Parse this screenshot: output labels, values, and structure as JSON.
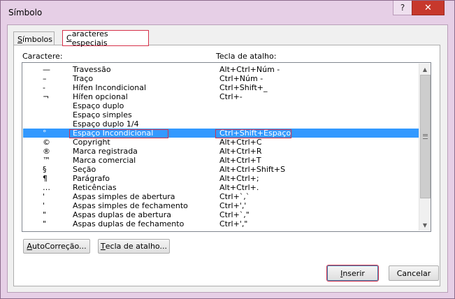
{
  "window": {
    "title": "Símbolo",
    "help_label": "?",
    "close_label": "✕"
  },
  "tabs": [
    {
      "label_accel": "S",
      "label_rest": "ímbolos"
    },
    {
      "label_accel": "C",
      "label_rest": "aracteres especiais"
    }
  ],
  "columns": {
    "character": "Caractere:",
    "shortcut": "Tecla de atalho:"
  },
  "rows": [
    {
      "char": "—",
      "name": "Travessão",
      "shortcut": "Alt+Ctrl+Núm -"
    },
    {
      "char": "–",
      "name": "Traço",
      "shortcut": "Ctrl+Núm -"
    },
    {
      "char": "‑",
      "name": "Hífen Incondicional",
      "shortcut": "Ctrl+Shift+_"
    },
    {
      "char": "¬",
      "name": "Hífen opcional",
      "shortcut": "Ctrl+-"
    },
    {
      "char": "",
      "name": "Espaço duplo",
      "shortcut": ""
    },
    {
      "char": "",
      "name": "Espaço simples",
      "shortcut": ""
    },
    {
      "char": "",
      "name": "Espaço duplo 1/4",
      "shortcut": ""
    },
    {
      "char": "°",
      "name": "Espaço Incondicional",
      "shortcut": "Ctrl+Shift+Espaço"
    },
    {
      "char": "©",
      "name": "Copyright",
      "shortcut": "Alt+Ctrl+C"
    },
    {
      "char": "®",
      "name": "Marca registrada",
      "shortcut": "Alt+Ctrl+R"
    },
    {
      "char": "™",
      "name": "Marca comercial",
      "shortcut": "Alt+Ctrl+T"
    },
    {
      "char": "§",
      "name": "Seção",
      "shortcut": "Alt+Ctrl+Shift+S"
    },
    {
      "char": "¶",
      "name": "Parágrafo",
      "shortcut": "Alt+Ctrl+;"
    },
    {
      "char": "…",
      "name": "Reticências",
      "shortcut": "Alt+Ctrl+."
    },
    {
      "char": "'",
      "name": "Aspas simples de abertura",
      "shortcut": "Ctrl+`,`"
    },
    {
      "char": "'",
      "name": "Aspas simples de fechamento",
      "shortcut": "Ctrl+','"
    },
    {
      "char": "\"",
      "name": "Aspas duplas de abertura",
      "shortcut": "Ctrl+`,\""
    },
    {
      "char": "\"",
      "name": "Aspas duplas de fechamento",
      "shortcut": "Ctrl+',\""
    }
  ],
  "selected_row": 7,
  "buttons": {
    "autocorrect": {
      "accel": "A",
      "rest": "utoCorreção..."
    },
    "shortcut_key": {
      "accel": "T",
      "rest": "ecla de atalho..."
    },
    "insert": {
      "accel": "I",
      "rest": "nserir"
    },
    "cancel": "Cancelar"
  },
  "colors": {
    "selection": "#3399ff",
    "highlight_outline": "#d6314a",
    "close": "#c7382c"
  }
}
